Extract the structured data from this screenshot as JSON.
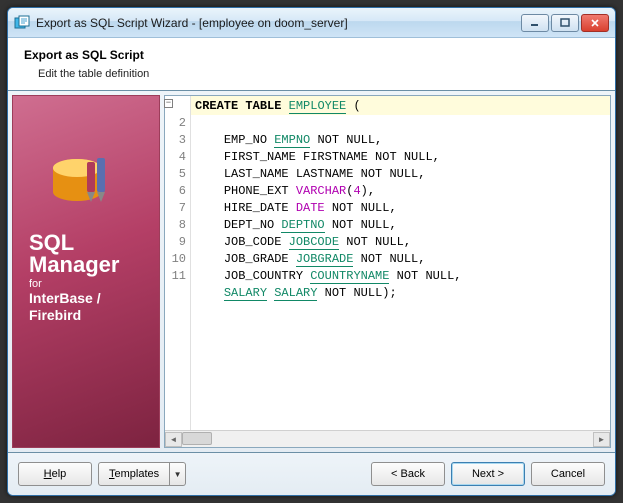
{
  "window": {
    "title": "Export as SQL Script Wizard - [employee on doom_server]"
  },
  "header": {
    "title": "Export as SQL Script",
    "subtitle": "Edit the table definition"
  },
  "sidebar": {
    "brand_line1": "SQL",
    "brand_line2": "Manager",
    "brand_for": "for",
    "brand_prod1": "InterBase /",
    "brand_prod2": "Firebird"
  },
  "editor": {
    "lines": {
      "l2": "2",
      "l3": "3",
      "l4": "4",
      "l5": "5",
      "l6": "6",
      "l7": "7",
      "l8": "8",
      "l9": "9",
      "l10": "10",
      "l11": "11"
    },
    "tokens": {
      "create": "CREATE",
      "table": "TABLE",
      "employee_link": "EMPLOYEE",
      "lparen": " (",
      "emp_no": "EMP_NO ",
      "empno_link": "EMPNO",
      "not_null_comma": " NOT NULL,",
      "first_name": "FIRST_NAME FIRSTNAME NOT NULL,",
      "last_name": "LAST_NAME LASTNAME NOT NULL,",
      "phone_ext": "PHONE_EXT ",
      "varchar": "VARCHAR",
      "paren_open": "(",
      "four": "4",
      "paren_close_comma": "),",
      "hire_date": "HIRE_DATE ",
      "date": "DATE",
      "dept_no": "DEPT_NO ",
      "deptno_link": "DEPTNO",
      "job_code": "JOB_CODE ",
      "jobcode_link": "JOBCODE",
      "job_grade": "JOB_GRADE ",
      "jobgrade_link": "JOBGRADE",
      "job_country": "JOB_COUNTRY ",
      "countryname_link": "COUNTRYNAME",
      "salary1_link": "SALARY",
      "space": " ",
      "salary2_link": "SALARY",
      "not_null_end": " NOT NULL);"
    }
  },
  "buttons": {
    "help": "Help",
    "templates": "Templates",
    "back": "< Back",
    "next": "Next >",
    "cancel": "Cancel"
  }
}
